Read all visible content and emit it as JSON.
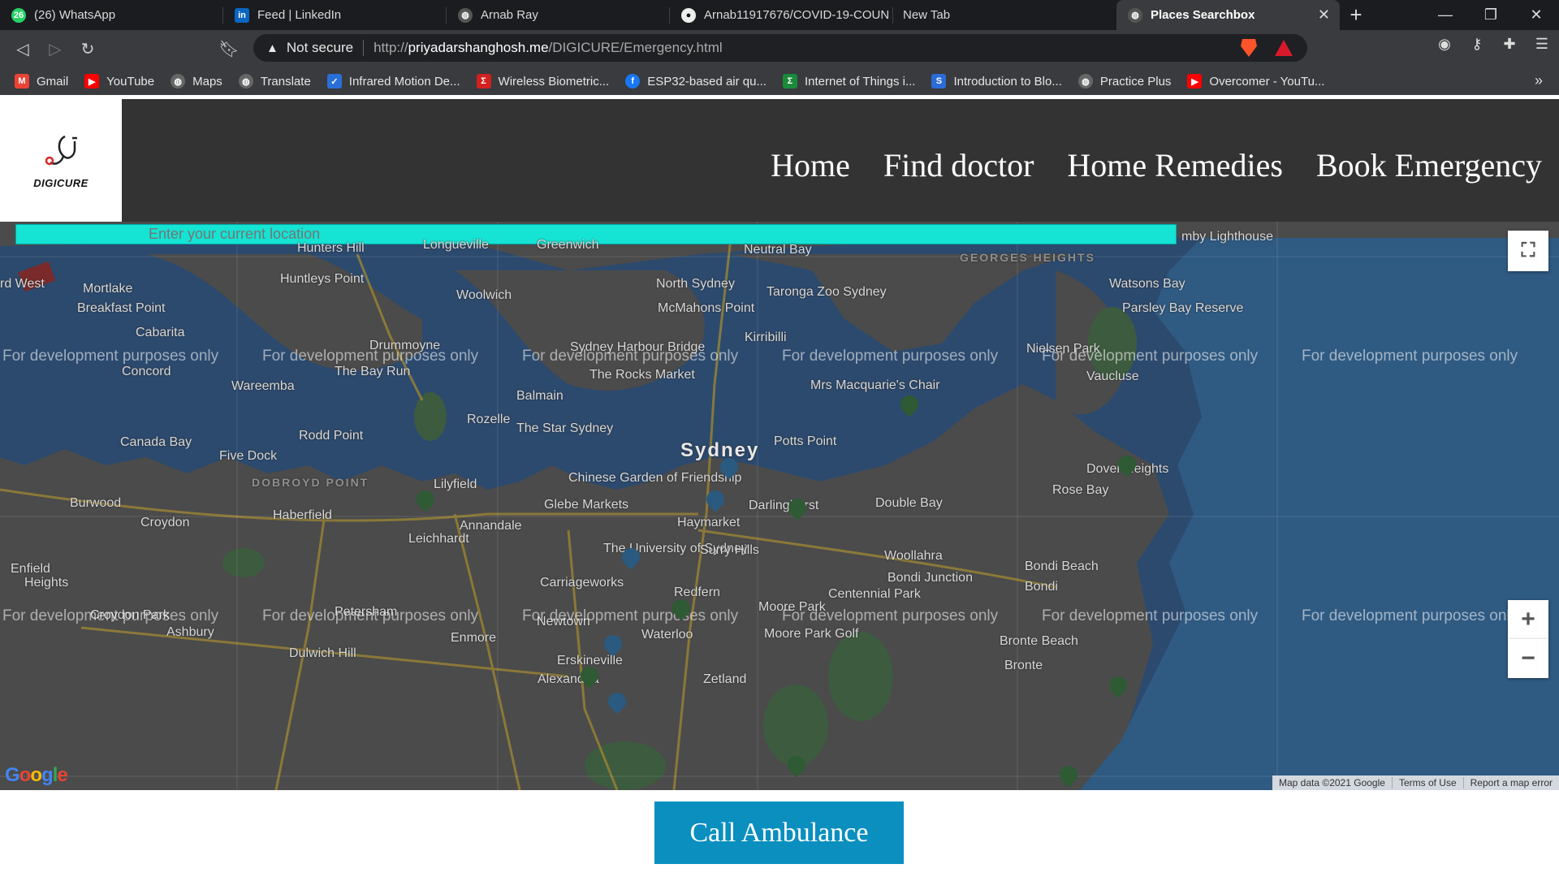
{
  "browser": {
    "tabs": [
      {
        "title": "(26) WhatsApp",
        "icon": "whatsapp-icon",
        "badge": "26",
        "color": "#25d366"
      },
      {
        "title": "Feed | LinkedIn",
        "icon": "linkedin-icon",
        "badge": "in",
        "color": "#0a66c2"
      },
      {
        "title": "Arnab Ray",
        "icon": "globe-icon",
        "badge": "",
        "color": "#555555"
      },
      {
        "title": "Arnab11917676/COVID-19-COUN",
        "icon": "github-icon",
        "badge": "",
        "color": "#111111"
      },
      {
        "title": "New Tab",
        "icon": "",
        "badge": "",
        "color": ""
      },
      {
        "title": "Places Searchbox",
        "icon": "globe-icon",
        "badge": "",
        "color": "#555555",
        "active": true
      }
    ],
    "address": {
      "security": "Not secure",
      "url_prefix": "http://",
      "url_host": "priyadarshanghosh.me",
      "url_path": "/DIGICURE/Emergency.html"
    },
    "bookmarks": [
      {
        "label": "Gmail",
        "icon": "gmail-icon",
        "color": "#ea4335",
        "glyph": "M"
      },
      {
        "label": "YouTube",
        "icon": "youtube-icon",
        "color": "#ff0000",
        "glyph": "▶"
      },
      {
        "label": "Maps",
        "icon": "globe-icon",
        "color": "#666666",
        "glyph": ""
      },
      {
        "label": "Translate",
        "icon": "globe-icon",
        "color": "#666666",
        "glyph": ""
      },
      {
        "label": "Infrared Motion De...",
        "icon": "site-icon",
        "color": "#2a6fd8",
        "glyph": "✓"
      },
      {
        "label": "Wireless Biometric...",
        "icon": "sigma-icon",
        "color": "#d32020",
        "glyph": "Σ"
      },
      {
        "label": "ESP32-based air qu...",
        "icon": "facebook-icon",
        "color": "#1877f2",
        "glyph": "f"
      },
      {
        "label": "Internet of Things i...",
        "icon": "sigma-icon",
        "color": "#1a8a3a",
        "glyph": "Σ"
      },
      {
        "label": "Introduction to Blo...",
        "icon": "s-icon",
        "color": "#2b6cd8",
        "glyph": "S"
      },
      {
        "label": "Practice Plus",
        "icon": "globe-icon",
        "color": "#666666",
        "glyph": ""
      },
      {
        "label": "Overcomer - YouTu...",
        "icon": "youtube-icon",
        "color": "#ff0000",
        "glyph": "▶"
      }
    ]
  },
  "site": {
    "logo_text": "DIGICURE",
    "nav": [
      "Home",
      "Find doctor",
      "Home Remedies",
      "Book Emergency"
    ]
  },
  "map": {
    "search_placeholder": "Enter your current location",
    "watermark": "For development purposes only",
    "places": [
      {
        "name": "Hunters Hill"
      },
      {
        "name": "Longueville"
      },
      {
        "name": "Greenwich"
      },
      {
        "name": "Neutral Bay"
      },
      {
        "name": "GEORGES HEIGHTS"
      },
      {
        "name": "rd West"
      },
      {
        "name": "Mortlake"
      },
      {
        "name": "Huntleys Point"
      },
      {
        "name": "Woolwich"
      },
      {
        "name": "North Sydney"
      },
      {
        "name": "Taronga Zoo Sydney"
      },
      {
        "name": "Watsons Bay"
      },
      {
        "name": "Breakfast Point"
      },
      {
        "name": "McMahons Point"
      },
      {
        "name": "Parsley Bay Reserve"
      },
      {
        "name": "Cabarita"
      },
      {
        "name": "Kirribilli"
      },
      {
        "name": "Sydney Harbour Bridge"
      },
      {
        "name": "Drummoyne"
      },
      {
        "name": "Nielsen Park"
      },
      {
        "name": "Concord"
      },
      {
        "name": "The Bay Run"
      },
      {
        "name": "The Rocks Market"
      },
      {
        "name": "Vaucluse"
      },
      {
        "name": "Mrs Macquarie's Chair"
      },
      {
        "name": "Wareemba"
      },
      {
        "name": "Balmain"
      },
      {
        "name": "Rozelle"
      },
      {
        "name": "Rodd Point"
      },
      {
        "name": "The Star Sydney"
      },
      {
        "name": "Canada Bay"
      },
      {
        "name": "Sydney"
      },
      {
        "name": "Potts Point"
      },
      {
        "name": "Five Dock"
      },
      {
        "name": "Dover Heights"
      },
      {
        "name": "DOBROYD POINT"
      },
      {
        "name": "Lilyfield"
      },
      {
        "name": "Chinese Garden of Friendship"
      },
      {
        "name": "Rose Bay"
      },
      {
        "name": "Burwood"
      },
      {
        "name": "Glebe Markets"
      },
      {
        "name": "Darlinghurst"
      },
      {
        "name": "Double Bay"
      },
      {
        "name": "Croydon"
      },
      {
        "name": "Haberfield"
      },
      {
        "name": "Annandale"
      },
      {
        "name": "Haymarket"
      },
      {
        "name": "Leichhardt"
      },
      {
        "name": "The University of Sydney"
      },
      {
        "name": "Surry Hills"
      },
      {
        "name": "Woollahra"
      },
      {
        "name": "Enfield"
      },
      {
        "name": "Heights"
      },
      {
        "name": "Carriageworks"
      },
      {
        "name": "Bondi Junction"
      },
      {
        "name": "Bondi Beach"
      },
      {
        "name": "Bondi"
      },
      {
        "name": "Redfern"
      },
      {
        "name": "Centennial Park"
      },
      {
        "name": "Moore Park"
      },
      {
        "name": "Croydon Park"
      },
      {
        "name": "Petersham"
      },
      {
        "name": "Ashbury"
      },
      {
        "name": "Newtown"
      },
      {
        "name": "Enmore"
      },
      {
        "name": "Waterloo"
      },
      {
        "name": "Moore Park Golf"
      },
      {
        "name": "Bronte Beach"
      },
      {
        "name": "Dulwich Hill"
      },
      {
        "name": "Erskineville"
      },
      {
        "name": "Bronte"
      },
      {
        "name": "Alexandria"
      },
      {
        "name": "Zetland"
      },
      {
        "name": "mby Lighthouse"
      }
    ],
    "attribution": [
      "Map data ©2021 Google",
      "Terms of Use",
      "Report a map error"
    ],
    "google_logo": "Google"
  },
  "actions": {
    "call_ambulance": "Call Ambulance"
  }
}
